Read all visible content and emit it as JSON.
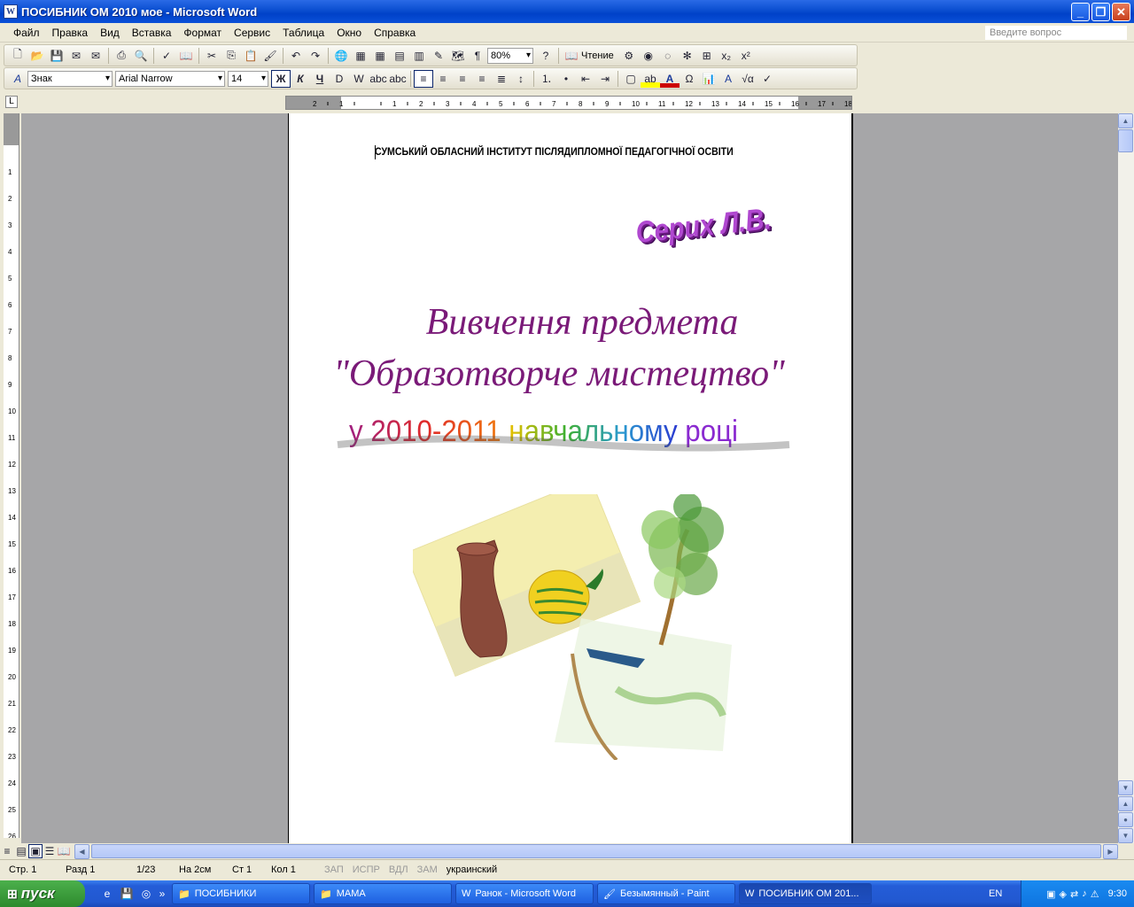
{
  "window": {
    "title": "ПОСИБНИК  ОМ 2010 мое - Microsoft Word"
  },
  "menu": {
    "items": [
      "Файл",
      "Правка",
      "Вид",
      "Вставка",
      "Формат",
      "Сервис",
      "Таблица",
      "Окно",
      "Справка"
    ],
    "help_placeholder": "Введите вопрос"
  },
  "toolbar": {
    "zoom": "80%",
    "reading": "Чтение"
  },
  "format": {
    "style": "Знак",
    "font": "Arial Narrow",
    "size": "14",
    "bold": "Ж",
    "italic": "К",
    "underline": "Ч"
  },
  "document": {
    "institute": "СУМСЬКИЙ ОБЛАСНИЙ ІНСТИТУТ ПІСЛЯДИПЛОМНОЇ ПЕДАГОГІЧНОЇ ОСВІТИ",
    "author": "Серих Л.В.",
    "title_line1": "Вивчення предмета",
    "title_line2": "\"Образотворче мистецтво\"",
    "year_part1": "у 2010-2011",
    "year_part2": "навчальному",
    "year_part3": "році"
  },
  "status": {
    "page": "Стр. 1",
    "section": "Разд 1",
    "pages": "1/23",
    "at": "На 2см",
    "line": "Ст 1",
    "col": "Кол 1",
    "rec": "ЗАП",
    "trk": "ИСПР",
    "ext": "ВДЛ",
    "ovr": "ЗАМ",
    "lang": "украинский"
  },
  "taskbar": {
    "start": "пуск",
    "tasks": [
      "ПОСИБНИКИ",
      "МАМА",
      "Ранок - Microsoft Word",
      "Безымянный - Paint",
      "ПОСИБНИК  ОМ 201..."
    ],
    "lang": "EN",
    "clock": "9:30"
  }
}
